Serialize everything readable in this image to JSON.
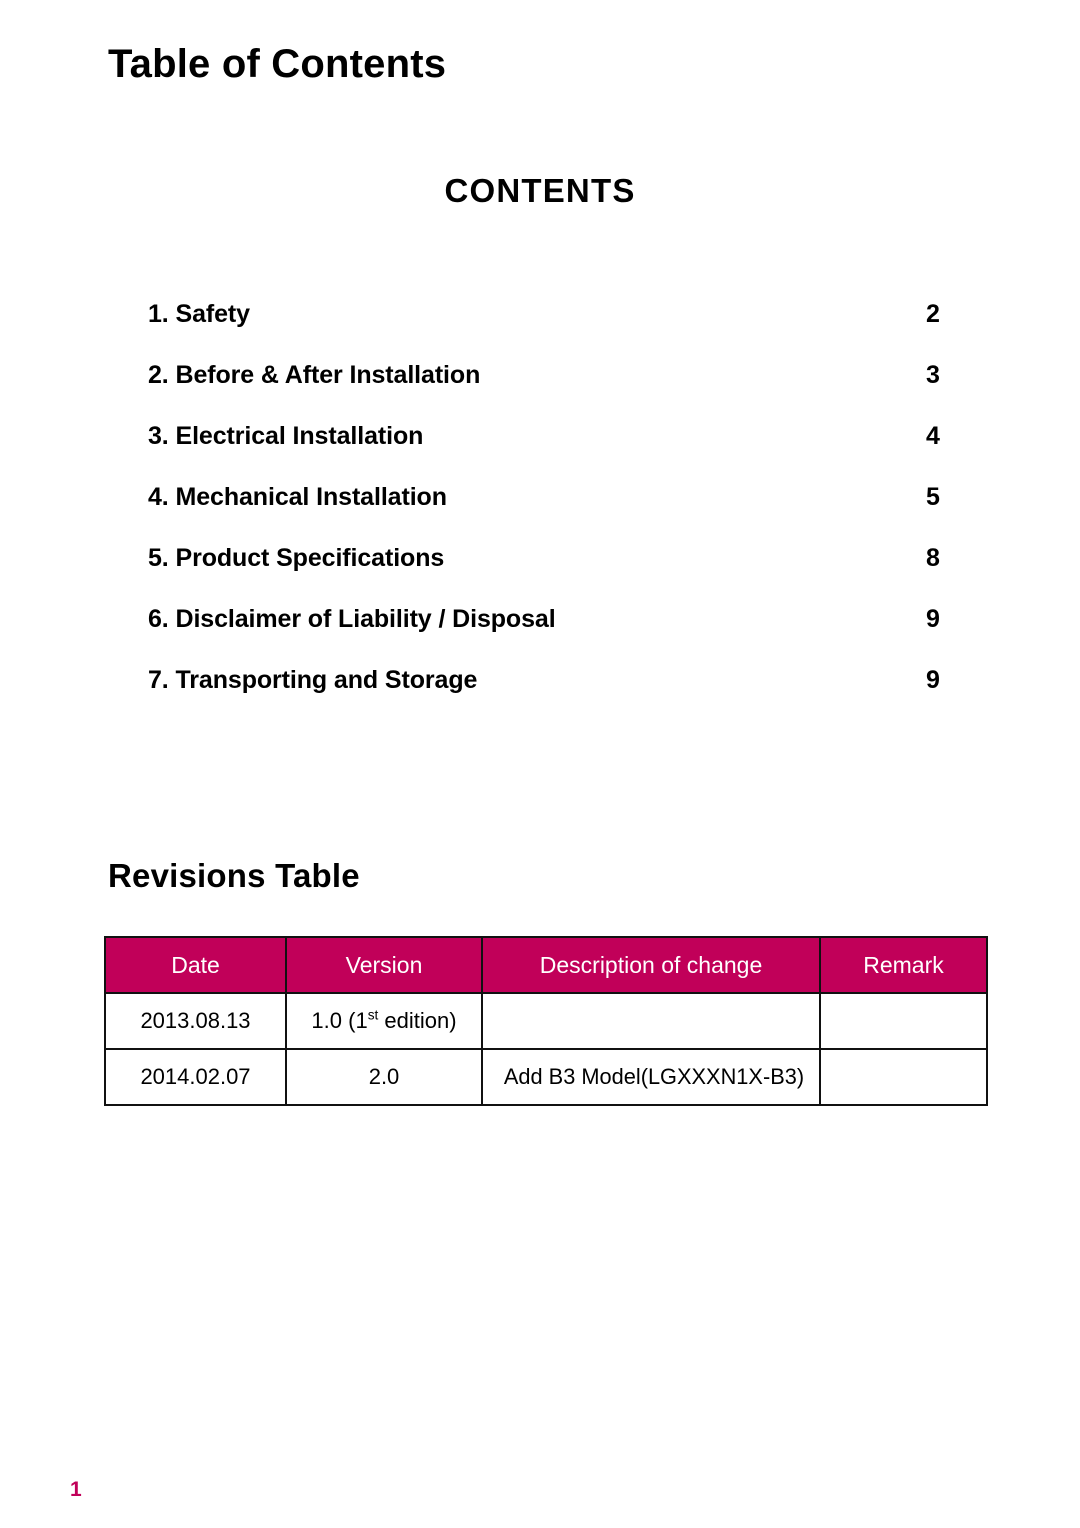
{
  "document": {
    "page_title": "Table of Contents",
    "contents_heading": "CONTENTS",
    "revisions_heading": "Revisions Table",
    "footer_page_number": "1",
    "accent_color": "#c10059"
  },
  "toc": {
    "entries": [
      {
        "label": "1. Safety",
        "page": "2"
      },
      {
        "label": "2. Before & After Installation",
        "page": "3"
      },
      {
        "label": "3. Electrical Installation",
        "page": "4"
      },
      {
        "label": "4. Mechanical Installation",
        "page": "5"
      },
      {
        "label": "5. Product Specifications",
        "page": "8"
      },
      {
        "label": "6. Disclaimer of Liability / Disposal",
        "page": "9"
      },
      {
        "label": "7. Transporting and Storage",
        "page": "9"
      }
    ]
  },
  "revisions_table": {
    "headers": [
      "Date",
      "Version",
      "Description of change",
      "Remark"
    ],
    "rows": [
      {
        "date": "2013.08.13",
        "version_prefix": "1.0 (1",
        "version_sup": "st",
        "version_suffix": " edition)",
        "description": "",
        "remark": ""
      },
      {
        "date": "2014.02.07",
        "version_prefix": "2.0",
        "version_sup": "",
        "version_suffix": "",
        "description": "Add B3 Model(LGXXXN1X-B3)",
        "remark": ""
      }
    ]
  }
}
